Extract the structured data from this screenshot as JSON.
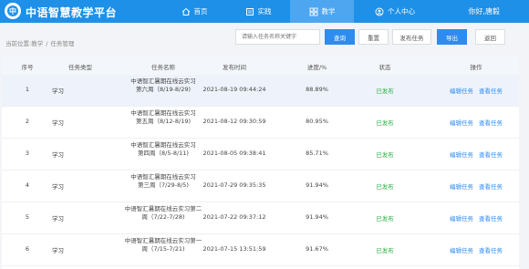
{
  "app": {
    "title": "中语智慧教学平台",
    "logo_char": "中"
  },
  "nav": [
    {
      "label": "首页",
      "icon": "home-icon"
    },
    {
      "label": "实践",
      "icon": "book-icon"
    },
    {
      "label": "教学",
      "icon": "grid-icon",
      "active": true
    },
    {
      "label": "个人中心",
      "icon": "user-icon"
    }
  ],
  "user": {
    "greeting": "你好,唐毅"
  },
  "breadcrumb": {
    "prefix": "当前位置:",
    "items": [
      "教学",
      "任务管理"
    ],
    "separator": "/"
  },
  "search": {
    "placeholder": "请输入任务名称关键字"
  },
  "toolbar": {
    "query": "查询",
    "reset": "重置",
    "publish": "发布任务",
    "export": "导出",
    "back": "返回"
  },
  "table": {
    "headers": [
      "序号",
      "任务类型",
      "任务名称",
      "发布时间",
      "进度/%",
      "状态",
      "操作"
    ],
    "rows": [
      {
        "no": "1",
        "type": "学习",
        "name_line1": "中语智汇暑期在线云实习",
        "name_line2": "第六周（8/19-8/29)",
        "time": "2021-08-19 09:44:24",
        "progress": "88.89%",
        "status": "已发布",
        "edit": "编辑任务",
        "view": "查看任务"
      },
      {
        "no": "2",
        "type": "学习",
        "name_line1": "中语智汇暑期在线云实习",
        "name_line2": "第五周（8/12-8/19)",
        "time": "2021-08-12 09:30:59",
        "progress": "80.95%",
        "status": "已发布",
        "edit": "编辑任务",
        "view": "查看任务"
      },
      {
        "no": "3",
        "type": "学习",
        "name_line1": "中语智汇暑期在线云实习",
        "name_line2": "第四周（8/5-8/11)",
        "time": "2021-08-05 09:38:41",
        "progress": "85.71%",
        "status": "已发布",
        "edit": "编辑任务",
        "view": "查看任务"
      },
      {
        "no": "4",
        "type": "学习",
        "name_line1": "中语智汇暑期在线云实习",
        "name_line2": "第三周（7/29-8/5)",
        "time": "2021-07-29 09:35:35",
        "progress": "91.94%",
        "status": "已发布",
        "edit": "编辑任务",
        "view": "查看任务"
      },
      {
        "no": "5",
        "type": "学习",
        "name_line1": "中语智汇暑期在线云实习第二",
        "name_line2": "周（7/22-7/28)",
        "time": "2021-07-22 09:37:12",
        "progress": "91.94%",
        "status": "已发布",
        "edit": "编辑任务",
        "view": "查看任务"
      },
      {
        "no": "6",
        "type": "学习",
        "name_line1": "中语智汇暑期在线云实习第一",
        "name_line2": "周（7/15-7/21)",
        "time": "2021-07-15 13:51:59",
        "progress": "91.67%",
        "status": "已发布",
        "edit": "编辑任务",
        "view": "查看任务"
      }
    ]
  },
  "colors": {
    "primary": "#1e90e8",
    "button": "#2d8cf0",
    "status_published": "#2fb045"
  }
}
